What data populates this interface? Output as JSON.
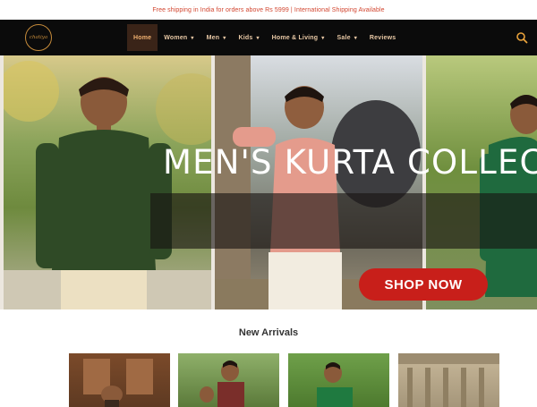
{
  "announcement": "Free shipping in India for orders above Rs 5999 | International Shipping Available",
  "brand": {
    "logo_text": "chatiya"
  },
  "nav": {
    "items": [
      {
        "label": "Home",
        "active": true,
        "dropdown": false
      },
      {
        "label": "Women",
        "active": false,
        "dropdown": true
      },
      {
        "label": "Men",
        "active": false,
        "dropdown": true
      },
      {
        "label": "Kids",
        "active": false,
        "dropdown": true
      },
      {
        "label": "Home & Living",
        "active": false,
        "dropdown": true
      },
      {
        "label": "Sale",
        "active": false,
        "dropdown": true
      },
      {
        "label": "Reviews",
        "active": false,
        "dropdown": false
      }
    ],
    "search_icon": "search-icon",
    "caret_icon": "chevron-down-icon"
  },
  "hero": {
    "title": "MEN'S KURTA COLLEC",
    "button": "SHOP NOW"
  },
  "new_arrivals": {
    "title": "New Arrivals"
  },
  "colors": {
    "accent": "#f0b070",
    "announcement": "#d2452f",
    "button": "#c81f1a",
    "nav_bg": "#0b0b0b"
  }
}
